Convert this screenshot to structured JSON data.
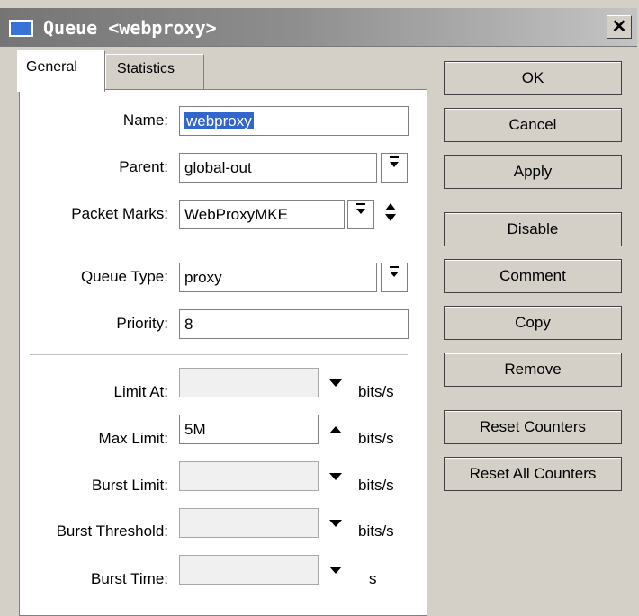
{
  "window": {
    "title": "Queue <webproxy>",
    "close_glyph": "✕"
  },
  "tabs": [
    {
      "label": "General",
      "active": true
    },
    {
      "label": "Statistics",
      "active": false
    }
  ],
  "form": {
    "name": {
      "label": "Name:",
      "value": "webproxy"
    },
    "parent": {
      "label": "Parent:",
      "value": "global-out"
    },
    "packet_marks": {
      "label": "Packet Marks:",
      "value": "WebProxyMKE"
    },
    "queue_type": {
      "label": "Queue Type:",
      "value": "proxy"
    },
    "priority": {
      "label": "Priority:",
      "value": "8"
    },
    "limit_at": {
      "label": "Limit At:",
      "value": "",
      "unit": "bits/s"
    },
    "max_limit": {
      "label": "Max Limit:",
      "value": "5M",
      "unit": "bits/s"
    },
    "burst_limit": {
      "label": "Burst Limit:",
      "value": "",
      "unit": "bits/s"
    },
    "burst_threshold": {
      "label": "Burst Threshold:",
      "value": "",
      "unit": "bits/s"
    },
    "burst_time": {
      "label": "Burst Time:",
      "value": "",
      "unit": "s"
    }
  },
  "buttons": {
    "ok": "OK",
    "cancel": "Cancel",
    "apply": "Apply",
    "disable": "Disable",
    "comment": "Comment",
    "copy": "Copy",
    "remove": "Remove",
    "reset_counters": "Reset Counters",
    "reset_all_counters": "Reset All Counters"
  },
  "colors": {
    "title_icon": "#3a73d7",
    "selection": "#3266cc"
  }
}
